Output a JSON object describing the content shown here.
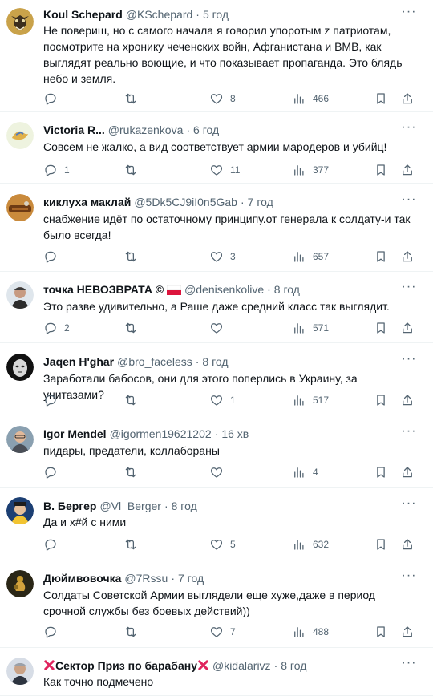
{
  "tweets": [
    {
      "name": "Koul Schepard",
      "handle": "@KSchepard",
      "time": "5 год",
      "text": "Не повериш, но с самого начала я говорил упоротым z патриотам, посмотрите на хронику чеченских войн, Афганистана и ВМВ, как выглядят реально воющие, и что показывает пропаганда. Это блядь небо и земля.",
      "replies": "",
      "retweets": "",
      "likes": "8",
      "views": "466"
    },
    {
      "name": "Victoria R...",
      "handle": "@rukazenkova",
      "time": "6 год",
      "text": "Совсем не жалко, а вид соответствует армии мародеров и убийц!",
      "replies": "1",
      "retweets": "",
      "likes": "11",
      "views": "377"
    },
    {
      "name": "киклуха маклай",
      "handle": "@5Dk5CJ9iI0n5Gab",
      "time": "7 год",
      "text": "снабжение идёт по остаточному принципу.от генерала к солдату-и так было всегда!",
      "replies": "",
      "retweets": "",
      "likes": "3",
      "views": "657"
    },
    {
      "name": "точка НЕВОЗВРАТА ©",
      "handle": "@denisenkolive",
      "time": "8 год",
      "text": "Это разве удивительно, а Раше даже средний класс так выглядит.",
      "replies": "2",
      "retweets": "",
      "likes": "",
      "views": "571"
    },
    {
      "name": "Jaqen H'ghar",
      "handle": "@bro_faceless",
      "time": "8 год",
      "text": "Заработали бабосов, они для этого поперлись в Украину, за унитазами?",
      "replies": "",
      "retweets": "",
      "likes": "1",
      "views": "517"
    },
    {
      "name": "Igor Mendel",
      "handle": "@igormen19621202",
      "time": "16 хв",
      "text": "пидары, предатели, коллабораны",
      "replies": "",
      "retweets": "",
      "likes": "",
      "views": "4"
    },
    {
      "name": "В. Бергер",
      "handle": "@Vl_Berger",
      "time": "8 год",
      "text": "Да и х#й с ними",
      "replies": "",
      "retweets": "",
      "likes": "5",
      "views": "632"
    },
    {
      "name": "Дюймвовочка",
      "handle": "@7Rssu",
      "time": "7 год",
      "text": "Солдаты Советской Армии выглядели еще хуже,даже в период срочной службы без боевых действий))",
      "replies": "",
      "retweets": "",
      "likes": "7",
      "views": "488"
    },
    {
      "name": "Сектор Приз по барабану",
      "handle": "@kidalarivz",
      "time": "8 год",
      "text": "Как точно подмечено",
      "replies": "",
      "retweets": "",
      "likes": "",
      "views": ""
    }
  ],
  "icons": {
    "more": "more-dots-icon",
    "reply": "reply-icon",
    "retweet": "retweet-icon",
    "like": "heart-icon",
    "views": "views-chart-icon",
    "bookmark": "bookmark-icon",
    "share": "share-icon",
    "flag": "poland-flag-icon",
    "cross": "red-cross-icon"
  },
  "colors": {
    "text": "#0f1419",
    "secondary": "#536471",
    "divider": "#eff3f4",
    "cross": "#e0245e"
  }
}
